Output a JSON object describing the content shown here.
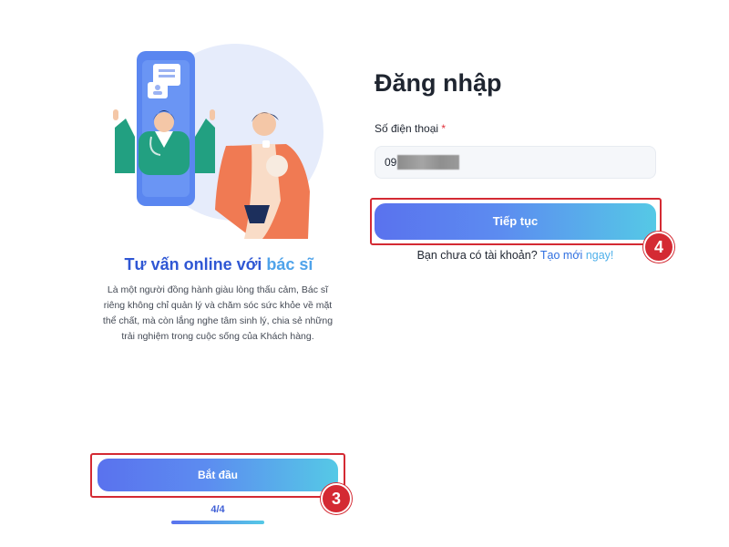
{
  "onboarding": {
    "title_main": "Tư vấn online với ",
    "title_accent": "bác sĩ",
    "description": "Là một người đồng hành giàu lòng thấu cảm, Bác sĩ riêng không chỉ quản lý và chăm sóc sức khỏe về mặt thể chất, mà còn lắng nghe tâm sinh lý, chia sẻ những trải nghiệm trong cuộc sống của Khách hàng.",
    "start_label": "Bắt đầu",
    "pager": {
      "text": "4/4",
      "current": 4,
      "total": 4
    },
    "annotation": "3"
  },
  "login": {
    "title": "Đăng nhập",
    "phone_label": "Số điện thoại",
    "required_mark": "*",
    "phone_value": "09",
    "continue_label": "Tiếp tục",
    "signup_prompt": "Bạn chưa có tài khoản?",
    "signup_link": "Tạo mới",
    "signup_link_suffix": "ngay!",
    "annotation": "4"
  },
  "colors": {
    "primary": "#5a72ee",
    "gradient_end": "#55c9e6",
    "title_blue": "#2f57d4",
    "highlight_red": "#d42a33",
    "link": "#2f6fe0"
  },
  "icons": [
    "chat-bubble-icon",
    "doctor-illustration",
    "patient-illustration",
    "phone-illustration"
  ]
}
